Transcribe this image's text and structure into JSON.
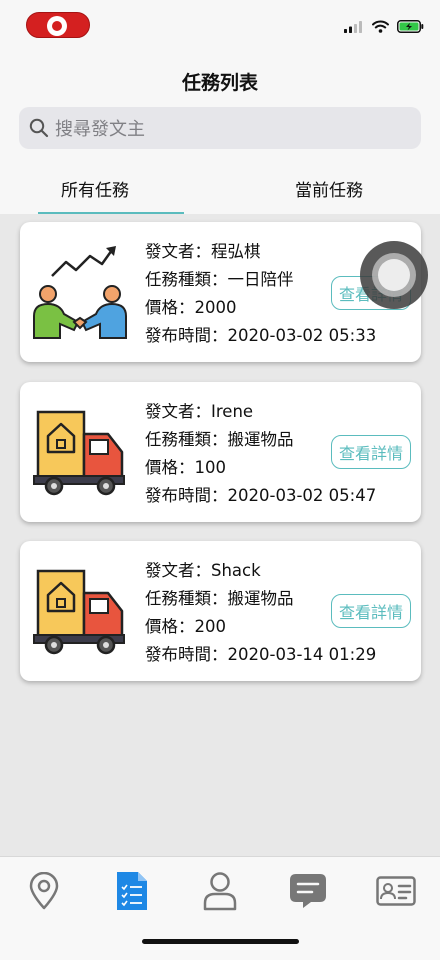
{
  "header": {
    "title": "任務列表",
    "search_placeholder": "搜尋發文主"
  },
  "tabs": [
    {
      "label": "所有任務",
      "active": true
    },
    {
      "label": "當前任務",
      "active": false
    }
  ],
  "tasks": [
    {
      "icon": "handshake-growth-icon",
      "poster": "發文者：程弘棋",
      "type": "任務種類：一日陪伴",
      "price": "價格：2000",
      "time": "發布時間：2020-03-02 05:33",
      "button": "查看詳情"
    },
    {
      "icon": "moving-truck-icon",
      "poster": "發文者：Irene",
      "type": "任務種類：搬運物品",
      "price": "價格：100",
      "time": "發布時間：2020-03-02 05:47",
      "button": "查看詳情"
    },
    {
      "icon": "moving-truck-icon",
      "poster": "發文者：Shack",
      "type": "任務種類：搬運物品",
      "price": "價格：200",
      "time": "發布時間：2020-03-14 01:29",
      "button": "查看詳情"
    }
  ],
  "bottom_nav": [
    {
      "icon": "map-pin-icon",
      "active": false
    },
    {
      "icon": "task-list-icon",
      "active": true
    },
    {
      "icon": "profile-icon",
      "active": false
    },
    {
      "icon": "chat-icon",
      "active": false
    },
    {
      "icon": "id-card-icon",
      "active": false
    }
  ],
  "colors": {
    "accent": "#5bbcbe",
    "active_nav": "#1e88e5",
    "recording": "#d42020"
  }
}
